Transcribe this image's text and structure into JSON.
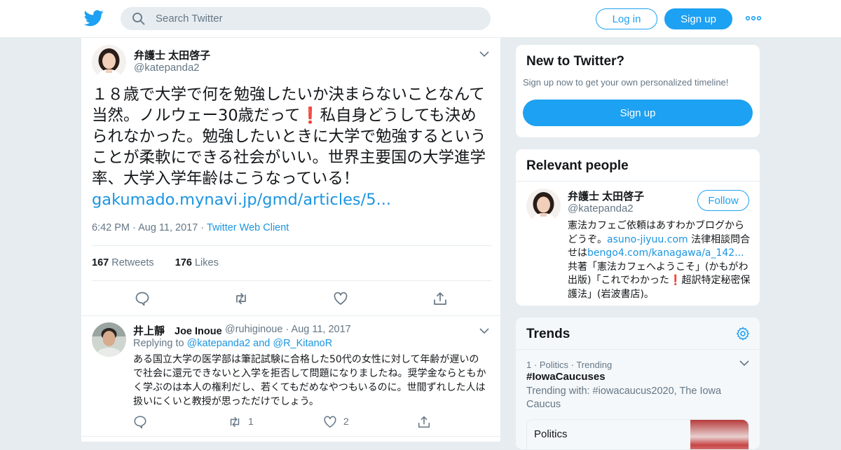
{
  "colors": {
    "accent": "#1da1f2",
    "link": "#1b95e0",
    "muted": "#657786",
    "text": "#14171a",
    "heart_alert": "#e0245e"
  },
  "topbar": {
    "search_placeholder": "Search Twitter",
    "login_label": "Log in",
    "signup_label": "Sign up",
    "logo_icon": "twitter-bird-icon",
    "more_icon": "more-dots-icon"
  },
  "tweet": {
    "fullname": "弁護士 太田啓子",
    "handle": "@katepanda2",
    "text_part1": "１８歳で大学で何を勉強したいか決まらないことなんて当然。ノルウェー30歳だって",
    "text_emoji": "❗",
    "text_part2": "私自身どうしても決められなかった。勉強したいときに大学で勉強するということが柔軟にできる社会がいい。世界主要国の大学進学率、大学入学年齢はこうなっている！",
    "link": "gakumado.mynavi.jp/gmd/articles/5...",
    "time": "6:42 PM",
    "date": "Aug 11, 2017",
    "client": "Twitter Web Client",
    "retweets_count": "167",
    "retweets_label": "Retweets",
    "likes_count": "176",
    "likes_label": "Likes"
  },
  "reply": {
    "fullname": "井上靜",
    "display2": "Joe Inoue",
    "handle": "@ruhiginoue",
    "date": "Aug 11, 2017",
    "replying_to_label": "Replying to",
    "replying_user1": "@katepanda2",
    "replying_and": "and",
    "replying_user2": "@R_KitanoR",
    "text": "ある国立大学の医学部は筆記試験に合格した50代の女性に対して年齢が遅いので社会に還元できないと入学を拒否して問題になりましたね。奨学金ならともかく学ぶのは本人の権利だし、若くてもだめなやつもいるのに。世間ずれした人は扱いにくいと教授が思っただけでしょう。",
    "retweet_count": "1",
    "like_count": "2"
  },
  "new_to_twitter": {
    "title": "New to Twitter?",
    "subtitle": "Sign up now to get your own personalized timeline!",
    "signup_label": "Sign up"
  },
  "relevant": {
    "title": "Relevant people",
    "fullname": "弁護士 太田啓子",
    "handle": "@katepanda2",
    "follow_label": "Follow",
    "bio_part1": "憲法カフェご依頼はあすわかブログからどうぞ。",
    "bio_link1": "asuno-jiyuu.com",
    "bio_part2": " 法律相談問合せは",
    "bio_link2": "bengo4.com/kanagawa/a_142...",
    "bio_part3": " 共著「憲法カフェへようこそ」(かもがわ出版)「これでわかった",
    "bio_emoji": "❗",
    "bio_part4": "超訳特定秘密保護法」(岩波書店)。"
  },
  "trends": {
    "title": "Trends",
    "rank": "1",
    "category": "Politics",
    "status": "Trending",
    "name": "#IowaCaucuses",
    "with_text": "Trending with: #iowacaucus2020, The Iowa Caucus",
    "news_category": "Politics"
  }
}
